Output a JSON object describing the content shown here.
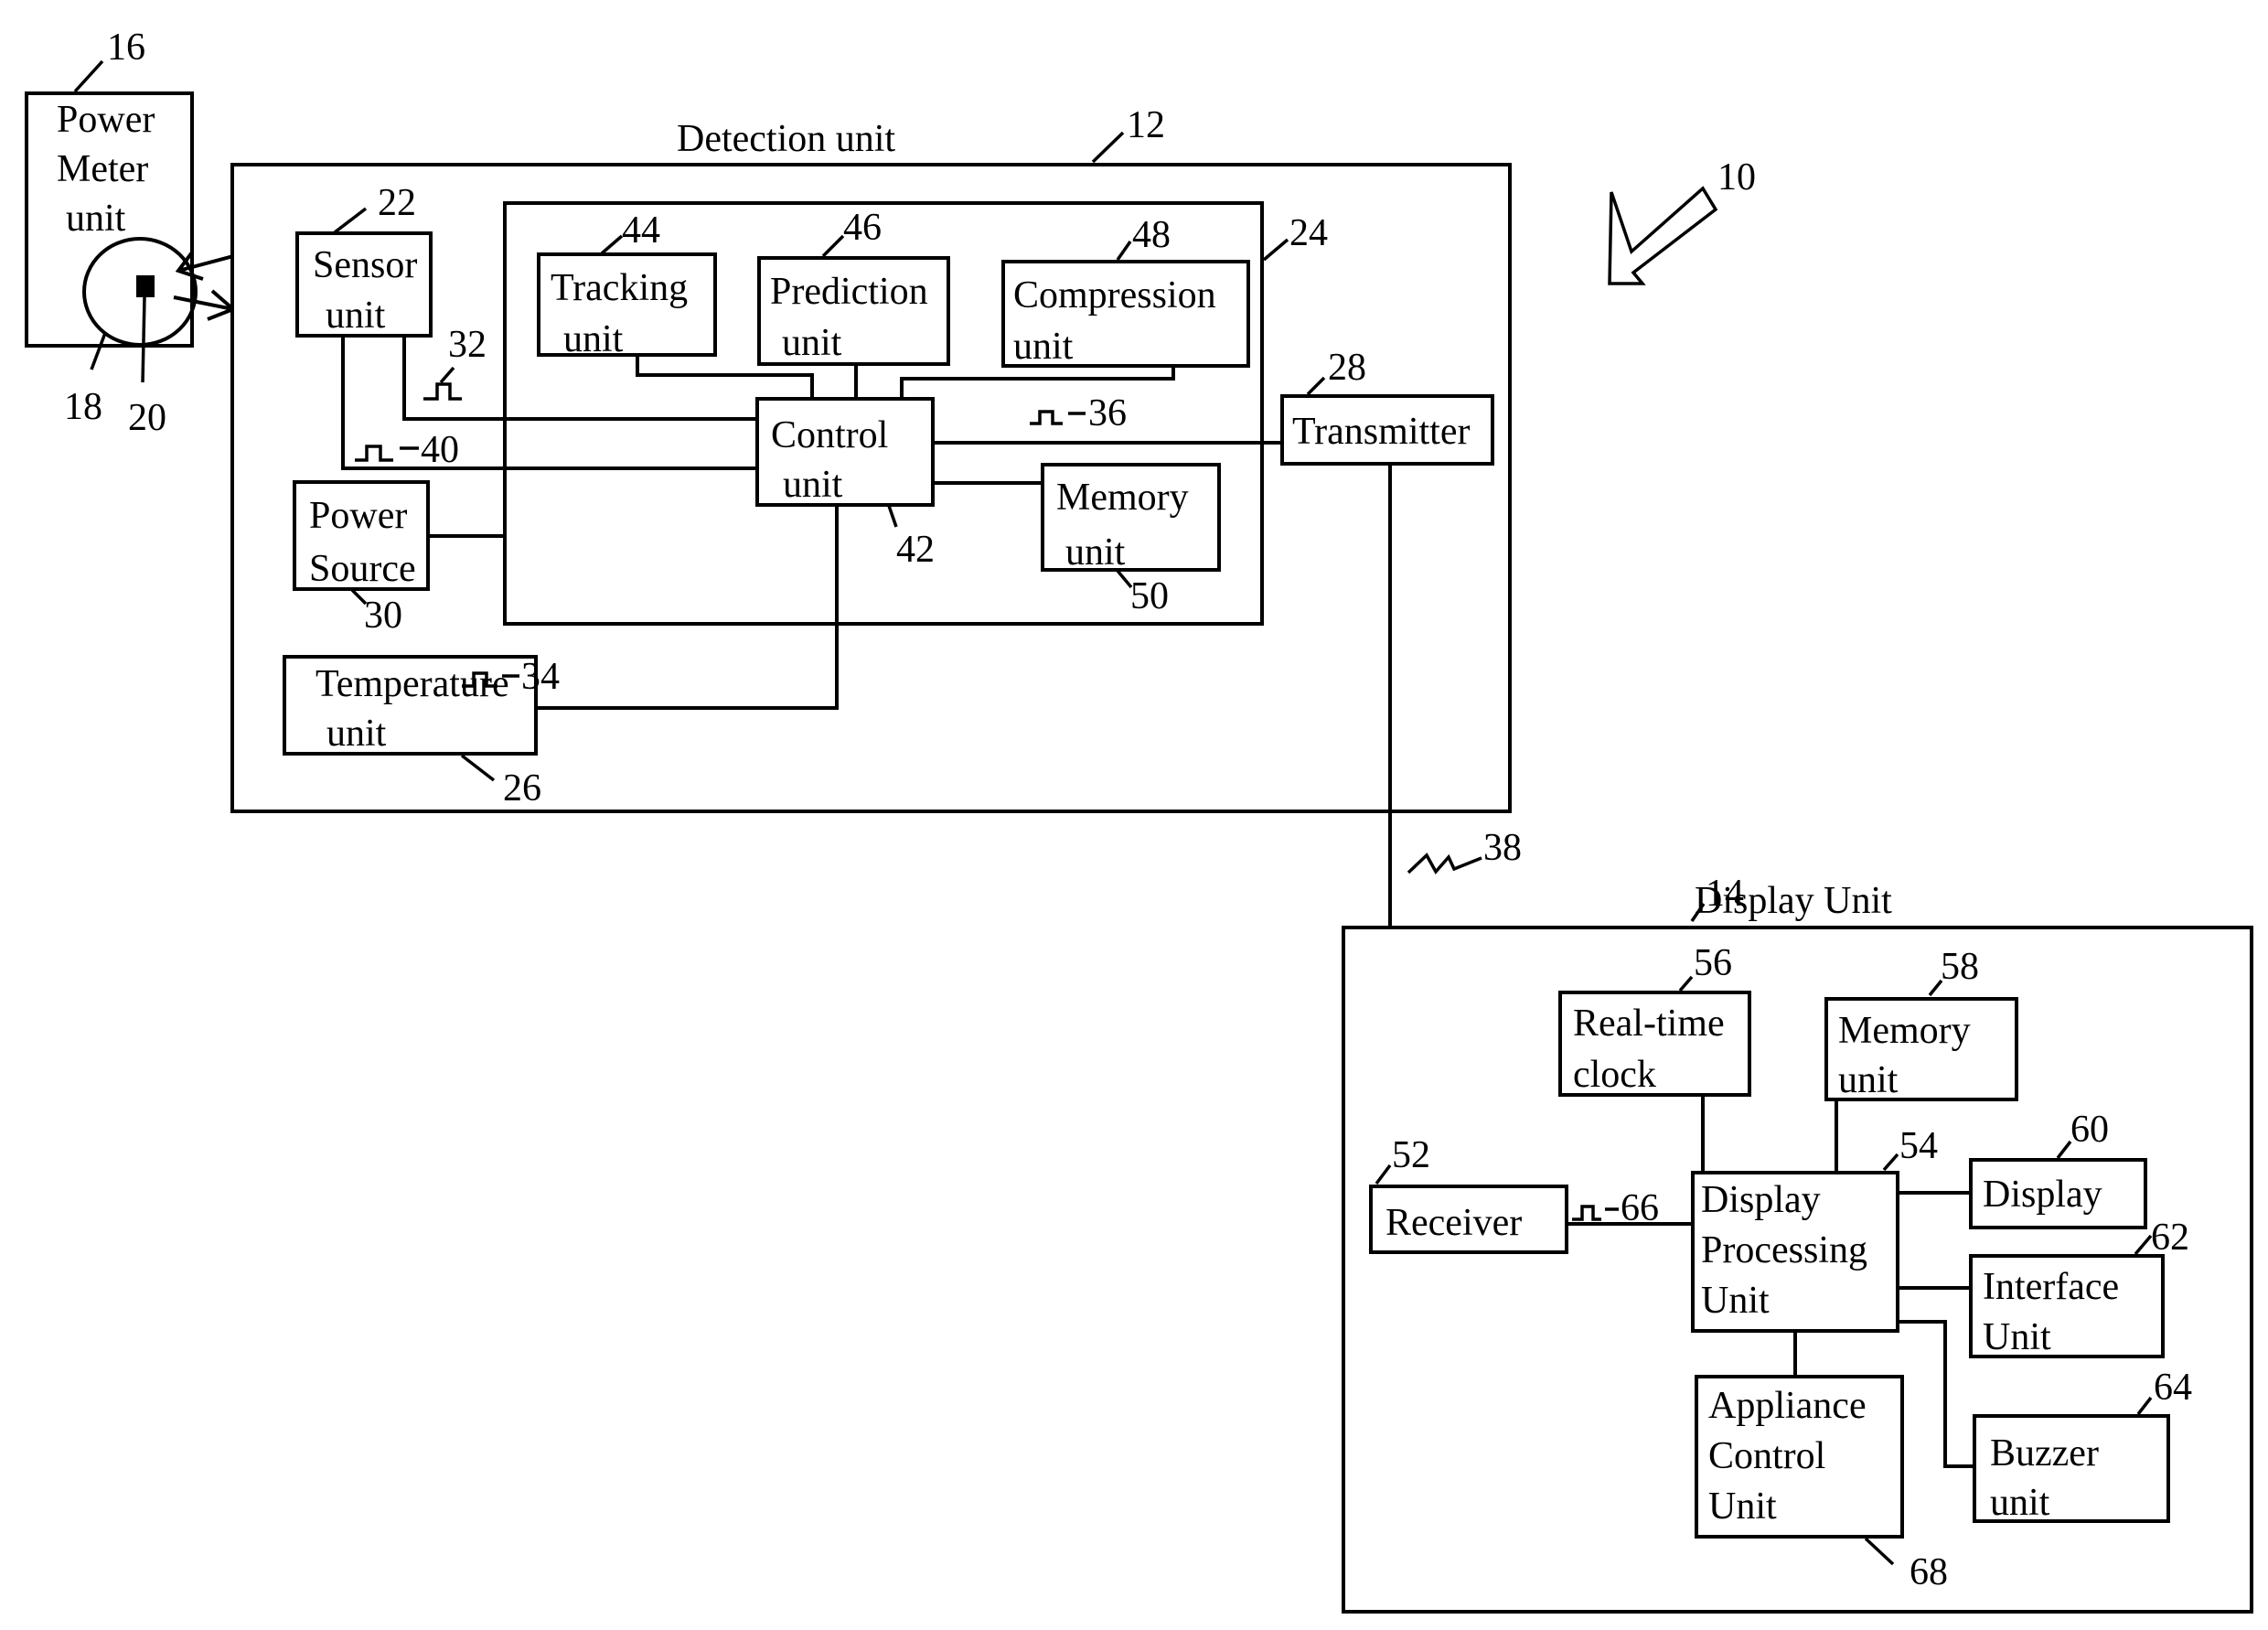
{
  "figure": {
    "system_ref": "10",
    "power_meter": {
      "lines": [
        "Power",
        "Meter",
        "unit"
      ],
      "ref": "16",
      "disc_ref": "18",
      "marker_ref": "20"
    },
    "detection_unit": {
      "title": "Detection unit",
      "ref": "12",
      "processor_ref": "24",
      "sensor": {
        "lines": [
          "Sensor",
          "unit"
        ],
        "ref": "22"
      },
      "power_source": {
        "lines": [
          "Power",
          "Source"
        ],
        "ref": "30"
      },
      "temperature": {
        "lines": [
          "Temperature",
          "unit"
        ],
        "ref": "26"
      },
      "tracking": {
        "lines": [
          "Tracking",
          "unit"
        ],
        "ref": "44"
      },
      "prediction": {
        "lines": [
          "Prediction",
          "unit"
        ],
        "ref": "46"
      },
      "compression": {
        "lines": [
          "Compression",
          "unit"
        ],
        "ref": "48"
      },
      "control": {
        "lines": [
          "Control",
          "unit"
        ],
        "ref": "42"
      },
      "memory": {
        "lines": [
          "Memory",
          "unit"
        ],
        "ref": "50"
      },
      "transmitter": {
        "lines": [
          "Transmitter"
        ],
        "ref": "28"
      },
      "signals": {
        "sensor_pulse": "32",
        "sensor_line": "40",
        "temperature_line": "34",
        "transmit_line": "36"
      }
    },
    "wireless_ref": "38",
    "display_unit": {
      "title": "Display Unit",
      "ref": "14",
      "receiver": {
        "lines": [
          "Receiver"
        ],
        "ref": "52"
      },
      "processing": {
        "lines": [
          "Display",
          "Processing",
          "Unit"
        ],
        "ref": "54"
      },
      "clock": {
        "lines": [
          "Real-time",
          "clock"
        ],
        "ref": "56"
      },
      "memory": {
        "lines": [
          "Memory",
          "unit"
        ],
        "ref": "58"
      },
      "display": {
        "lines": [
          "Display"
        ],
        "ref": "60"
      },
      "interface": {
        "lines": [
          "Interface",
          "Unit"
        ],
        "ref": "62"
      },
      "buzzer": {
        "lines": [
          "Buzzer",
          "unit"
        ],
        "ref": "64"
      },
      "appliance": {
        "lines": [
          "Appliance",
          "Control",
          "Unit"
        ],
        "ref": "68"
      },
      "signal_ref": "66"
    }
  }
}
